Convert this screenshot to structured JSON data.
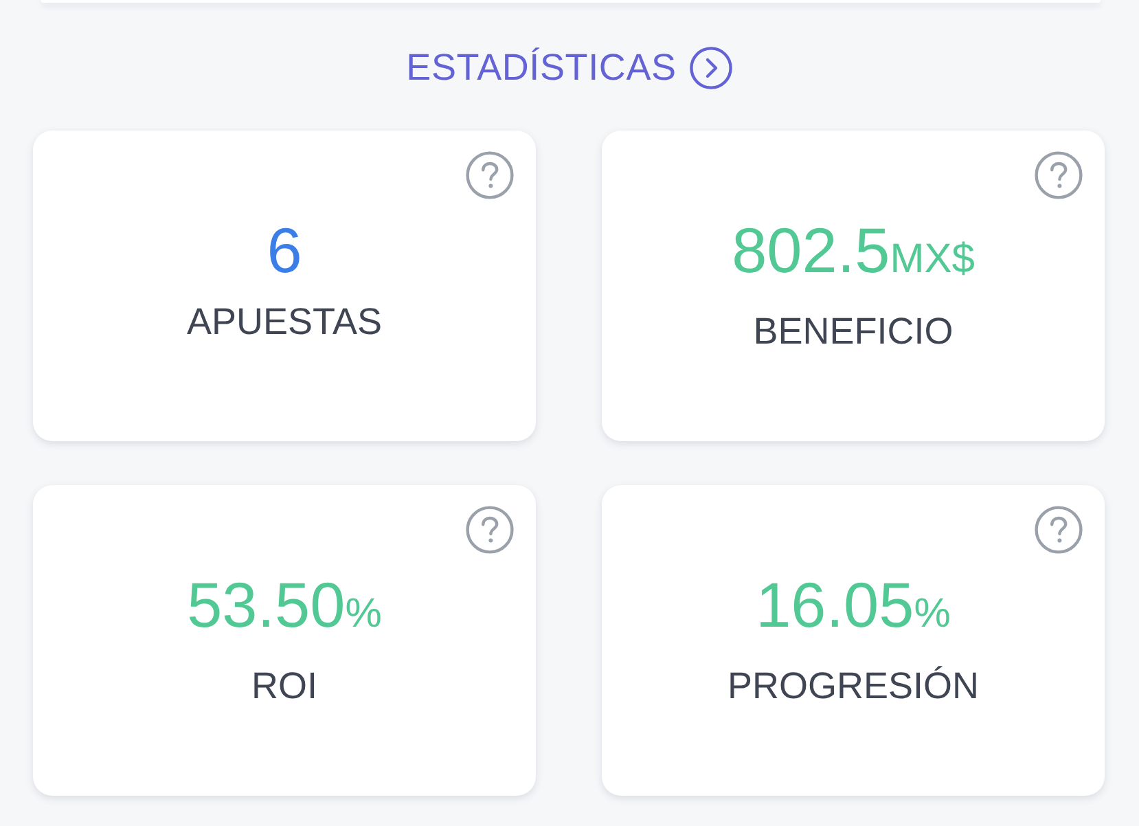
{
  "section": {
    "title": "ESTADÍSTICAS"
  },
  "stats": [
    {
      "value": "6",
      "label": "APUESTAS",
      "color": "#3b7ee8"
    },
    {
      "value": "802.5",
      "unit": "MX$",
      "label": "BENEFICIO",
      "color": "#52c994"
    },
    {
      "value": "53.50",
      "unit": "%",
      "label": "ROI",
      "color": "#52c994"
    },
    {
      "value": "16.05",
      "unit": "%",
      "label": "PROGRESIÓN",
      "color": "#52c994"
    }
  ]
}
